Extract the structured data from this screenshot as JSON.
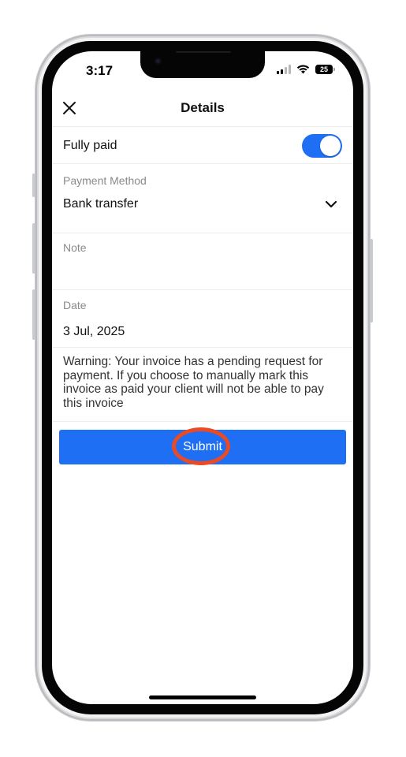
{
  "status_bar": {
    "time": "3:17",
    "battery_level": "25"
  },
  "header": {
    "title": "Details",
    "close_icon": "close-icon"
  },
  "fully_paid": {
    "label": "Fully paid",
    "enabled": true
  },
  "payment_method": {
    "label": "Payment Method",
    "value": "Bank transfer"
  },
  "note": {
    "label": "Note",
    "value": ""
  },
  "date": {
    "label": "Date",
    "value": "3 Jul, 2025"
  },
  "warning": {
    "text": "Warning: Your invoice has a pending request for payment. If you choose to manually mark this invoice as paid your client will not be able to pay this invoice"
  },
  "submit": {
    "label": "Submit"
  },
  "colors": {
    "accent": "#1f6ff5",
    "highlight": "#ea4b25"
  }
}
